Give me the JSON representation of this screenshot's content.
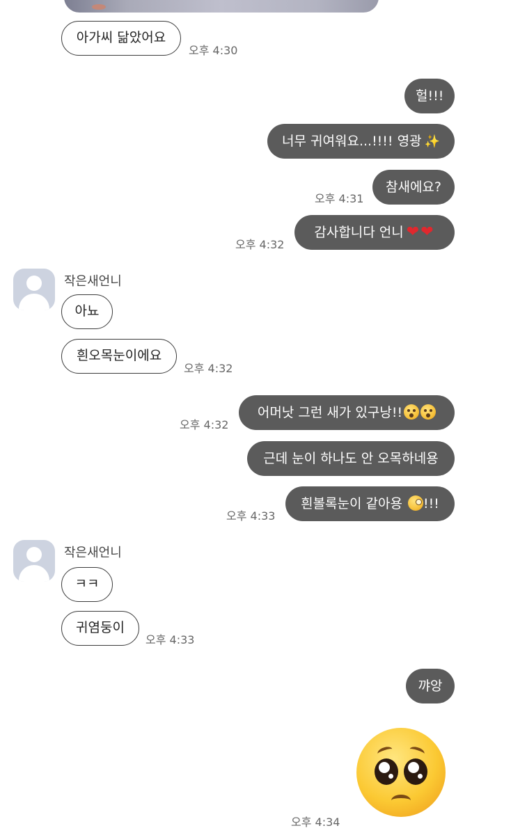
{
  "contact": {
    "name": "작은새언니"
  },
  "messages": [
    {
      "text": "아가씨 닮았어요",
      "time": "오후 4:30"
    },
    {
      "text": "헐!!!"
    },
    {
      "text": "너무 귀여워요...!!!! 영광"
    },
    {
      "text": "참새에요?",
      "time": "오후 4:31"
    },
    {
      "text": "감사합니다 언니",
      "time": "오후 4:32"
    },
    {
      "text": "아뇨"
    },
    {
      "text": "흰오목눈이에요",
      "time": "오후 4:32"
    },
    {
      "text": "어머낫 그런 새가 있구낭!!",
      "time": "오후 4:32"
    },
    {
      "text": "근데 눈이 하나도 안 오목하네용"
    },
    {
      "text": "흰볼록눈이 같아용",
      "suffix": "!!!",
      "time": "오후 4:33"
    },
    {
      "text": "ㅋㅋ"
    },
    {
      "text": "귀염둥이",
      "time": "오후 4:33"
    },
    {
      "text": "꺄앙"
    },
    {
      "emoji": "pleading-face",
      "time": "오후 4:34"
    }
  ]
}
